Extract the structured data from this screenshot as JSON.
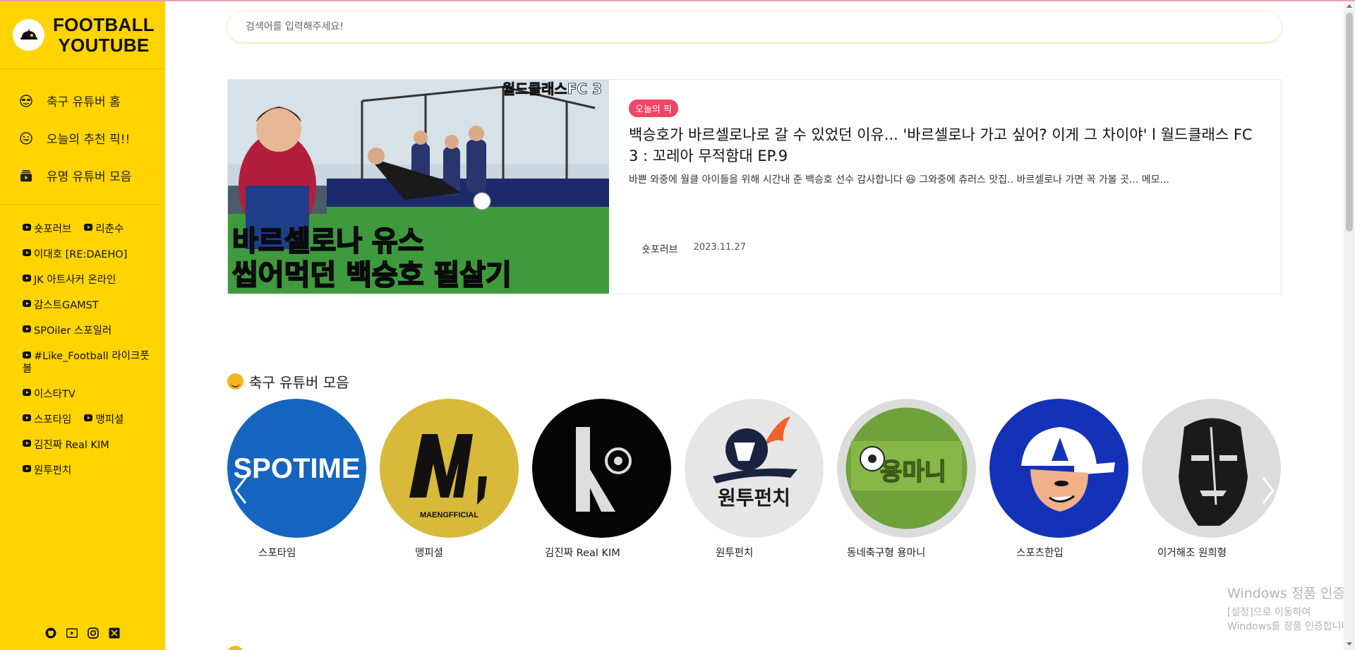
{
  "brand": {
    "line1": "FOOTBALL",
    "line2": "YOUTUBE"
  },
  "nav": [
    {
      "label": "축구 유튜버 홈",
      "icon": "cool-face-icon"
    },
    {
      "label": "오늘의 추천 픽!!",
      "icon": "tongue-face-icon"
    },
    {
      "label": "유명 유튜버 모음",
      "icon": "video-stack-icon"
    }
  ],
  "channels": {
    "row1": [
      "숏포러브",
      "리춘수"
    ],
    "row2": [
      "이대호 [RE:DAEHO]"
    ],
    "row3": [
      "JK 아트사커 온라인"
    ],
    "row4": [
      "감스트GAMST"
    ],
    "row5": [
      "SPOiler 스포일러"
    ],
    "row6": [
      "#Like_Football 라이크풋볼"
    ],
    "row7": [
      "이스타TV"
    ],
    "row8": [
      "스포타임",
      "맹피셜"
    ],
    "row9": [
      "김진짜 Real KIM"
    ],
    "row10": [
      "원투펀치"
    ]
  },
  "social": [
    "github-icon",
    "youtube-icon",
    "instagram-icon",
    "x-icon"
  ],
  "search": {
    "placeholder": "검색어를 입력해주세요!"
  },
  "pick": {
    "badge": "오늘의 픽",
    "title": "백승호가 바르셀로나로 갈 수 있었던 이유... '바르셀로나 가고 싶어? 이게 그 차이야' l 월드클래스 FC 3 : 꼬레아 무적함대 EP.9",
    "description": "바쁜 와중에 월클 아이들을 위해 시간내 준 백승호 선수 감사합니다 😆 그와중에 츄러스 맛집.. 바르셀로나 가면 꼭 가볼 곳... 메모...",
    "channel": "숏포러브",
    "date": "2023.11.27",
    "thumb_text": {
      "corner": "월드클래스FC 3",
      "line1": "바르셀로나 유스",
      "line2": "씹어먹던 백승호 필살기"
    }
  },
  "section": {
    "title": "축구 유튜버 모음"
  },
  "youtubers": [
    {
      "name": "스포타임",
      "logo_text": "SPOTIME"
    },
    {
      "name": "맹피셜",
      "logo_text": "MAENGFFICIAL"
    },
    {
      "name": "김진짜 Real KIM"
    },
    {
      "name": "원투펀치",
      "logo_text": "원투펀치"
    },
    {
      "name": "동네축구형 용마니",
      "logo_text": "용마니"
    },
    {
      "name": "스포츠한입"
    },
    {
      "name": "이거해조 원희형"
    }
  ],
  "windows": {
    "line1": "Windows 정품 인증",
    "line2": "[설정]으로 이동하여 Windows를 정품 인증합니다."
  },
  "colors": {
    "sidebar": "#ffd400",
    "badge": "#f04565",
    "spotime": "#1565c0"
  }
}
